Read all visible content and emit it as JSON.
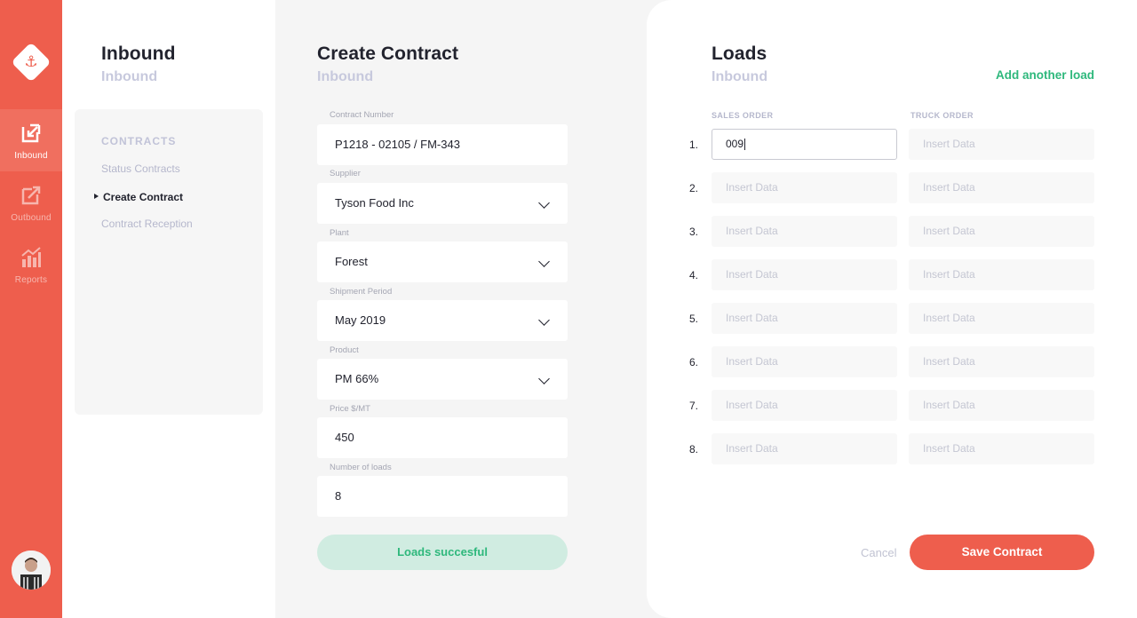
{
  "rail": {
    "items": [
      {
        "label": "Inbound",
        "icon": "inbound-icon"
      },
      {
        "label": "Outbound",
        "icon": "outbound-icon"
      },
      {
        "label": "Reports",
        "icon": "reports-icon"
      }
    ]
  },
  "nav": {
    "title": "Inbound",
    "subtitle": "Inbound",
    "section": "CONTRACTS",
    "links": [
      "Status Contracts",
      "Create Contract",
      "Contract Reception"
    ]
  },
  "form": {
    "title": "Create Contract",
    "subtitle": "Inbound",
    "fields": [
      {
        "label": "Contract Number",
        "value": "P1218 - 02105 / FM-343"
      },
      {
        "label": "Supplier",
        "value": "Tyson Food Inc"
      },
      {
        "label": "Plant",
        "value": "Forest"
      },
      {
        "label": "Shipment Period",
        "value": "May 2019"
      },
      {
        "label": "Product",
        "value": "PM 66%"
      },
      {
        "label": "Price $/MT",
        "value": "450"
      },
      {
        "label": "Number of loads",
        "value": "8"
      }
    ],
    "status": "Loads succesful"
  },
  "loads": {
    "title": "Loads",
    "subtitle": "Inbound",
    "add_link": "Add another load",
    "col_sales": "SALES ORDER",
    "col_truck": "TRUCK ORDER",
    "placeholder": "Insert Data",
    "rows": [
      {
        "num": "1.",
        "sales": "009",
        "truck": ""
      },
      {
        "num": "2.",
        "sales": "",
        "truck": ""
      },
      {
        "num": "3.",
        "sales": "",
        "truck": ""
      },
      {
        "num": "4.",
        "sales": "",
        "truck": ""
      },
      {
        "num": "5.",
        "sales": "",
        "truck": ""
      },
      {
        "num": "6.",
        "sales": "",
        "truck": ""
      },
      {
        "num": "7.",
        "sales": "",
        "truck": ""
      },
      {
        "num": "8.",
        "sales": "",
        "truck": ""
      }
    ],
    "cancel": "Cancel",
    "save": "Save Contract"
  },
  "colors": {
    "accent": "#ee5e4d",
    "success": "#2eb87c"
  }
}
